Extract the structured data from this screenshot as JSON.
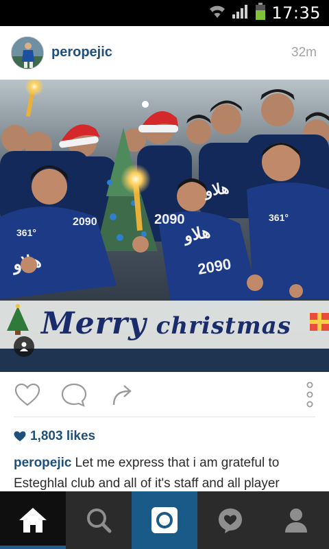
{
  "status_bar": {
    "time": "17:35"
  },
  "post": {
    "username": "peropejic",
    "time_ago": "32m",
    "photo": {
      "banner_text_1": "Merry",
      "banner_text_2": "christmas"
    },
    "likes_text": "1,803 likes",
    "caption_user": "peropejic",
    "caption_text": "Let me express that i am grateful to Esteghlal club and all of it's staff and all player"
  },
  "colors": {
    "link_blue": "#1f4f7b",
    "nav_active": "#1e5d8c",
    "nav_bg": "#2b2b2b",
    "status_bar": "#000000"
  },
  "icons": {
    "status": [
      "wifi-icon",
      "signal-icon",
      "battery-icon"
    ],
    "actions": [
      "heart-icon",
      "comment-icon",
      "share-icon",
      "more-vertical-icon"
    ],
    "nav": [
      "home-icon",
      "search-icon",
      "camera-icon",
      "activity-heart-icon",
      "profile-icon"
    ]
  }
}
